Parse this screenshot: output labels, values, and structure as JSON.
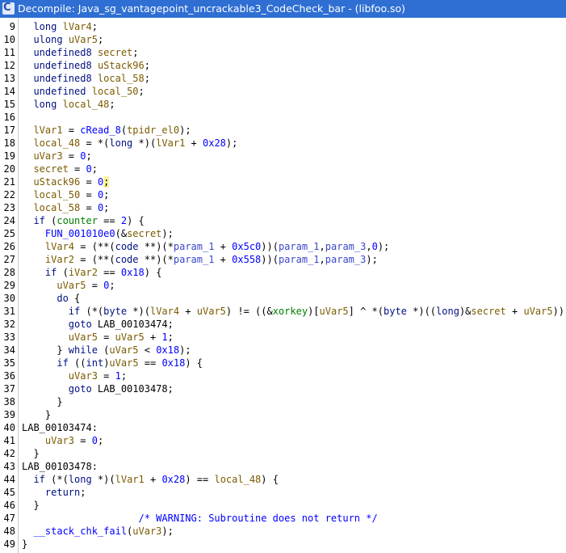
{
  "window": {
    "title": "Decompile: Java_sg_vantagepoint_uncrackable3_CodeCheck_bar - (libfoo.so)",
    "icon": "ghidra-decompiler-icon",
    "icon_glyph": "C"
  },
  "colors": {
    "titlebar": "#2f6fd3",
    "keyword": "#001080",
    "function": "#0000ff",
    "variable": "#7a5c00",
    "global": "#008000",
    "parameter": "#3a47c9",
    "comment": "#0000ff",
    "highlight": "#fbf39a"
  },
  "lines": [
    {
      "num": "9",
      "tokens": [
        {
          "t": "  ",
          "c": "plain"
        },
        {
          "t": "long",
          "c": "kw"
        },
        {
          "t": " ",
          "c": "plain"
        },
        {
          "t": "lVar4",
          "c": "var"
        },
        {
          "t": ";",
          "c": "plain"
        }
      ]
    },
    {
      "num": "10",
      "tokens": [
        {
          "t": "  ",
          "c": "plain"
        },
        {
          "t": "ulong",
          "c": "kw"
        },
        {
          "t": " ",
          "c": "plain"
        },
        {
          "t": "uVar5",
          "c": "var"
        },
        {
          "t": ";",
          "c": "plain"
        }
      ]
    },
    {
      "num": "11",
      "tokens": [
        {
          "t": "  ",
          "c": "plain"
        },
        {
          "t": "undefined8",
          "c": "kw"
        },
        {
          "t": " ",
          "c": "plain"
        },
        {
          "t": "secret",
          "c": "var"
        },
        {
          "t": ";",
          "c": "plain"
        }
      ]
    },
    {
      "num": "12",
      "tokens": [
        {
          "t": "  ",
          "c": "plain"
        },
        {
          "t": "undefined8",
          "c": "kw"
        },
        {
          "t": " ",
          "c": "plain"
        },
        {
          "t": "uStack96",
          "c": "var"
        },
        {
          "t": ";",
          "c": "plain"
        }
      ]
    },
    {
      "num": "13",
      "tokens": [
        {
          "t": "  ",
          "c": "plain"
        },
        {
          "t": "undefined8",
          "c": "kw"
        },
        {
          "t": " ",
          "c": "plain"
        },
        {
          "t": "local_58",
          "c": "var"
        },
        {
          "t": ";",
          "c": "plain"
        }
      ]
    },
    {
      "num": "14",
      "tokens": [
        {
          "t": "  ",
          "c": "plain"
        },
        {
          "t": "undefined",
          "c": "kw"
        },
        {
          "t": " ",
          "c": "plain"
        },
        {
          "t": "local_50",
          "c": "var"
        },
        {
          "t": ";",
          "c": "plain"
        }
      ]
    },
    {
      "num": "15",
      "tokens": [
        {
          "t": "  ",
          "c": "plain"
        },
        {
          "t": "long",
          "c": "kw"
        },
        {
          "t": " ",
          "c": "plain"
        },
        {
          "t": "local_48",
          "c": "var"
        },
        {
          "t": ";",
          "c": "plain"
        }
      ]
    },
    {
      "num": "16",
      "tokens": []
    },
    {
      "num": "17",
      "tokens": [
        {
          "t": "  ",
          "c": "plain"
        },
        {
          "t": "lVar1",
          "c": "var"
        },
        {
          "t": " = ",
          "c": "plain"
        },
        {
          "t": "cRead_8",
          "c": "fn"
        },
        {
          "t": "(",
          "c": "plain"
        },
        {
          "t": "tpidr_el0",
          "c": "var"
        },
        {
          "t": ");",
          "c": "plain"
        }
      ]
    },
    {
      "num": "18",
      "tokens": [
        {
          "t": "  ",
          "c": "plain"
        },
        {
          "t": "local_48",
          "c": "var"
        },
        {
          "t": " = *(",
          "c": "plain"
        },
        {
          "t": "long",
          "c": "kw"
        },
        {
          "t": " *)(",
          "c": "plain"
        },
        {
          "t": "lVar1",
          "c": "var"
        },
        {
          "t": " + ",
          "c": "plain"
        },
        {
          "t": "0x28",
          "c": "fn"
        },
        {
          "t": ");",
          "c": "plain"
        }
      ]
    },
    {
      "num": "19",
      "tokens": [
        {
          "t": "  ",
          "c": "plain"
        },
        {
          "t": "uVar3",
          "c": "var"
        },
        {
          "t": " = ",
          "c": "plain"
        },
        {
          "t": "0",
          "c": "fn"
        },
        {
          "t": ";",
          "c": "plain"
        }
      ]
    },
    {
      "num": "20",
      "tokens": [
        {
          "t": "  ",
          "c": "plain"
        },
        {
          "t": "secret",
          "c": "var"
        },
        {
          "t": " = ",
          "c": "plain"
        },
        {
          "t": "0",
          "c": "fn"
        },
        {
          "t": ";",
          "c": "plain"
        }
      ]
    },
    {
      "num": "21",
      "tokens": [
        {
          "t": "  ",
          "c": "plain"
        },
        {
          "t": "uStack96",
          "c": "var"
        },
        {
          "t": " = ",
          "c": "plain"
        },
        {
          "t": "0",
          "c": "fn"
        },
        {
          "t": ";",
          "c": "hl"
        }
      ]
    },
    {
      "num": "22",
      "tokens": [
        {
          "t": "  ",
          "c": "plain"
        },
        {
          "t": "local_50",
          "c": "var"
        },
        {
          "t": " = ",
          "c": "plain"
        },
        {
          "t": "0",
          "c": "fn"
        },
        {
          "t": ";",
          "c": "plain"
        }
      ]
    },
    {
      "num": "23",
      "tokens": [
        {
          "t": "  ",
          "c": "plain"
        },
        {
          "t": "local_58",
          "c": "var"
        },
        {
          "t": " = ",
          "c": "plain"
        },
        {
          "t": "0",
          "c": "fn"
        },
        {
          "t": ";",
          "c": "plain"
        }
      ]
    },
    {
      "num": "24",
      "tokens": [
        {
          "t": "  ",
          "c": "plain"
        },
        {
          "t": "if",
          "c": "kw"
        },
        {
          "t": " (",
          "c": "plain"
        },
        {
          "t": "counter",
          "c": "global"
        },
        {
          "t": " == ",
          "c": "plain"
        },
        {
          "t": "2",
          "c": "fn"
        },
        {
          "t": ") {",
          "c": "plain"
        }
      ]
    },
    {
      "num": "25",
      "tokens": [
        {
          "t": "    ",
          "c": "plain"
        },
        {
          "t": "FUN_001010e0",
          "c": "fn"
        },
        {
          "t": "(&",
          "c": "plain"
        },
        {
          "t": "secret",
          "c": "var"
        },
        {
          "t": ");",
          "c": "plain"
        }
      ]
    },
    {
      "num": "26",
      "tokens": [
        {
          "t": "    ",
          "c": "plain"
        },
        {
          "t": "lVar4",
          "c": "var"
        },
        {
          "t": " = (**(",
          "c": "plain"
        },
        {
          "t": "code",
          "c": "kw"
        },
        {
          "t": " **)(*",
          "c": "plain"
        },
        {
          "t": "param_1",
          "c": "param"
        },
        {
          "t": " + ",
          "c": "plain"
        },
        {
          "t": "0x5c0",
          "c": "fn"
        },
        {
          "t": "))(",
          "c": "plain"
        },
        {
          "t": "param_1",
          "c": "param"
        },
        {
          "t": ",",
          "c": "plain"
        },
        {
          "t": "param_3",
          "c": "param"
        },
        {
          "t": ",",
          "c": "plain"
        },
        {
          "t": "0",
          "c": "fn"
        },
        {
          "t": ");",
          "c": "plain"
        }
      ]
    },
    {
      "num": "27",
      "tokens": [
        {
          "t": "    ",
          "c": "plain"
        },
        {
          "t": "iVar2",
          "c": "var"
        },
        {
          "t": " = (**(",
          "c": "plain"
        },
        {
          "t": "code",
          "c": "kw"
        },
        {
          "t": " **)(*",
          "c": "plain"
        },
        {
          "t": "param_1",
          "c": "param"
        },
        {
          "t": " + ",
          "c": "plain"
        },
        {
          "t": "0x558",
          "c": "fn"
        },
        {
          "t": "))(",
          "c": "plain"
        },
        {
          "t": "param_1",
          "c": "param"
        },
        {
          "t": ",",
          "c": "plain"
        },
        {
          "t": "param_3",
          "c": "param"
        },
        {
          "t": ");",
          "c": "plain"
        }
      ]
    },
    {
      "num": "28",
      "tokens": [
        {
          "t": "    ",
          "c": "plain"
        },
        {
          "t": "if",
          "c": "kw"
        },
        {
          "t": " (",
          "c": "plain"
        },
        {
          "t": "iVar2",
          "c": "var"
        },
        {
          "t": " == ",
          "c": "plain"
        },
        {
          "t": "0x18",
          "c": "fn"
        },
        {
          "t": ") {",
          "c": "plain"
        }
      ]
    },
    {
      "num": "29",
      "tokens": [
        {
          "t": "      ",
          "c": "plain"
        },
        {
          "t": "uVar5",
          "c": "var"
        },
        {
          "t": " = ",
          "c": "plain"
        },
        {
          "t": "0",
          "c": "fn"
        },
        {
          "t": ";",
          "c": "plain"
        }
      ]
    },
    {
      "num": "30",
      "tokens": [
        {
          "t": "      ",
          "c": "plain"
        },
        {
          "t": "do",
          "c": "kw"
        },
        {
          "t": " {",
          "c": "plain"
        }
      ]
    },
    {
      "num": "31",
      "tokens": [
        {
          "t": "        ",
          "c": "plain"
        },
        {
          "t": "if",
          "c": "kw"
        },
        {
          "t": " (*(",
          "c": "plain"
        },
        {
          "t": "byte",
          "c": "kw"
        },
        {
          "t": " *)(",
          "c": "plain"
        },
        {
          "t": "lVar4",
          "c": "var"
        },
        {
          "t": " + ",
          "c": "plain"
        },
        {
          "t": "uVar5",
          "c": "var"
        },
        {
          "t": ") != ((&",
          "c": "plain"
        },
        {
          "t": "xorkey",
          "c": "global"
        },
        {
          "t": ")[",
          "c": "plain"
        },
        {
          "t": "uVar5",
          "c": "var"
        },
        {
          "t": "] ^ *(",
          "c": "plain"
        },
        {
          "t": "byte",
          "c": "kw"
        },
        {
          "t": " *)((",
          "c": "plain"
        },
        {
          "t": "long",
          "c": "kw"
        },
        {
          "t": ")&",
          "c": "plain"
        },
        {
          "t": "secret",
          "c": "var"
        },
        {
          "t": " + ",
          "c": "plain"
        },
        {
          "t": "uVar5",
          "c": "var"
        },
        {
          "t": ")))",
          "c": "plain"
        }
      ]
    },
    {
      "num": "32",
      "tokens": [
        {
          "t": "        ",
          "c": "plain"
        },
        {
          "t": "goto",
          "c": "kw"
        },
        {
          "t": " LAB_00103474;",
          "c": "label"
        }
      ]
    },
    {
      "num": "33",
      "tokens": [
        {
          "t": "        ",
          "c": "plain"
        },
        {
          "t": "uVar5",
          "c": "var"
        },
        {
          "t": " = ",
          "c": "plain"
        },
        {
          "t": "uVar5",
          "c": "var"
        },
        {
          "t": " + ",
          "c": "plain"
        },
        {
          "t": "1",
          "c": "fn"
        },
        {
          "t": ";",
          "c": "plain"
        }
      ]
    },
    {
      "num": "34",
      "tokens": [
        {
          "t": "      } ",
          "c": "plain"
        },
        {
          "t": "while",
          "c": "kw"
        },
        {
          "t": " (",
          "c": "plain"
        },
        {
          "t": "uVar5",
          "c": "var"
        },
        {
          "t": " < ",
          "c": "plain"
        },
        {
          "t": "0x18",
          "c": "fn"
        },
        {
          "t": ");",
          "c": "plain"
        }
      ]
    },
    {
      "num": "35",
      "tokens": [
        {
          "t": "      ",
          "c": "plain"
        },
        {
          "t": "if",
          "c": "kw"
        },
        {
          "t": " ((",
          "c": "plain"
        },
        {
          "t": "int",
          "c": "kw"
        },
        {
          "t": ")",
          "c": "plain"
        },
        {
          "t": "uVar5",
          "c": "var"
        },
        {
          "t": " == ",
          "c": "plain"
        },
        {
          "t": "0x18",
          "c": "fn"
        },
        {
          "t": ") {",
          "c": "plain"
        }
      ]
    },
    {
      "num": "36",
      "tokens": [
        {
          "t": "        ",
          "c": "plain"
        },
        {
          "t": "uVar3",
          "c": "var"
        },
        {
          "t": " = ",
          "c": "plain"
        },
        {
          "t": "1",
          "c": "fn"
        },
        {
          "t": ";",
          "c": "plain"
        }
      ]
    },
    {
      "num": "37",
      "tokens": [
        {
          "t": "        ",
          "c": "plain"
        },
        {
          "t": "goto",
          "c": "kw"
        },
        {
          "t": " LAB_00103478;",
          "c": "label"
        }
      ]
    },
    {
      "num": "38",
      "tokens": [
        {
          "t": "      }",
          "c": "plain"
        }
      ]
    },
    {
      "num": "39",
      "tokens": [
        {
          "t": "    }",
          "c": "plain"
        }
      ]
    },
    {
      "num": "40",
      "tokens": [
        {
          "t": "LAB_00103474:",
          "c": "label"
        }
      ]
    },
    {
      "num": "41",
      "tokens": [
        {
          "t": "    ",
          "c": "plain"
        },
        {
          "t": "uVar3",
          "c": "var"
        },
        {
          "t": " = ",
          "c": "plain"
        },
        {
          "t": "0",
          "c": "fn"
        },
        {
          "t": ";",
          "c": "plain"
        }
      ]
    },
    {
      "num": "42",
      "tokens": [
        {
          "t": "  }",
          "c": "plain"
        }
      ]
    },
    {
      "num": "43",
      "tokens": [
        {
          "t": "LAB_00103478:",
          "c": "label"
        }
      ]
    },
    {
      "num": "44",
      "tokens": [
        {
          "t": "  ",
          "c": "plain"
        },
        {
          "t": "if",
          "c": "kw"
        },
        {
          "t": " (*(",
          "c": "plain"
        },
        {
          "t": "long",
          "c": "kw"
        },
        {
          "t": " *)(",
          "c": "plain"
        },
        {
          "t": "lVar1",
          "c": "var"
        },
        {
          "t": " + ",
          "c": "plain"
        },
        {
          "t": "0x28",
          "c": "fn"
        },
        {
          "t": ") == ",
          "c": "plain"
        },
        {
          "t": "local_48",
          "c": "var"
        },
        {
          "t": ") {",
          "c": "plain"
        }
      ]
    },
    {
      "num": "45",
      "tokens": [
        {
          "t": "    ",
          "c": "plain"
        },
        {
          "t": "return",
          "c": "kw"
        },
        {
          "t": ";",
          "c": "plain"
        }
      ]
    },
    {
      "num": "46",
      "tokens": [
        {
          "t": "  }",
          "c": "plain"
        }
      ]
    },
    {
      "num": "47",
      "tokens": [
        {
          "t": "                    ",
          "c": "plain"
        },
        {
          "t": "/* WARNING: Subroutine does not return */",
          "c": "comment"
        }
      ]
    },
    {
      "num": "48",
      "tokens": [
        {
          "t": "  ",
          "c": "plain"
        },
        {
          "t": "__stack_chk_fail",
          "c": "fn"
        },
        {
          "t": "(",
          "c": "plain"
        },
        {
          "t": "uVar3",
          "c": "var"
        },
        {
          "t": ");",
          "c": "plain"
        }
      ]
    },
    {
      "num": "49",
      "tokens": [
        {
          "t": "}",
          "c": "plain"
        }
      ]
    }
  ]
}
